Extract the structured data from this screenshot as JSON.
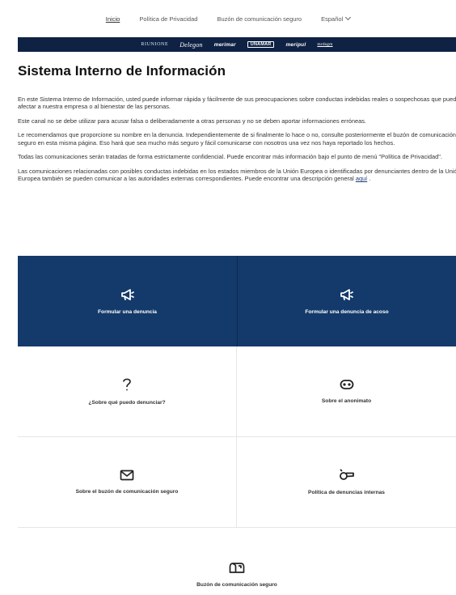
{
  "topnav": {
    "items": [
      {
        "label": "Inicio",
        "active": true
      },
      {
        "label": "Política de Privacidad",
        "active": false
      },
      {
        "label": "Buzón de comunicación seguro",
        "active": false
      }
    ],
    "language": "Español"
  },
  "brands": [
    "RIUNIONE",
    "Delegon",
    "merimar",
    "UNAMAR",
    "meripul",
    "mrdsgm"
  ],
  "page": {
    "title": "Sistema Interno de Información",
    "paragraphs": [
      "En este Sistema Interno de Información, usted puede informar rápida y fácilmente de sus preocupaciones sobre conductas indebidas reales o sospechosas que puedan afectar a nuestra empresa o al bienestar de las personas.",
      "Este canal no se debe utilizar para acusar falsa o deliberadamente a otras personas y no se deben aportar informaciones erróneas.",
      "Le recomendamos que proporcione su nombre en la denuncia. Independientemente de si finalmente lo hace o no, consulte posteriormente el buzón de comunicación seguro en esta misma página. Eso hará que sea mucho más seguro y fácil comunicarse con nosotros una vez nos haya reportado los hechos.",
      "Todas las comunicaciones serán tratadas de forma estrictamente confidencial. Puede encontrar más información bajo el punto de menú \"Política de Privacidad\"."
    ],
    "last_paragraph_text": "Las comunicaciones relacionadas con posibles conductas indebidas en los estados miembros de la Unión Europea o identificadas por denunciantes dentro de la Unión Europea también se pueden comunicar a las autoridades externas correspondientes. Puede encontrar una descripción general ",
    "last_paragraph_link": "aquí",
    "last_paragraph_end": " ."
  },
  "tiles": {
    "report": {
      "label": "Formular una denuncia",
      "icon": "megaphone-icon"
    },
    "harassment": {
      "label": "Formular una denuncia de acoso",
      "icon": "megaphone-icon"
    },
    "what_to_report": {
      "label": "¿Sobre qué puedo denunciar?",
      "icon": "question-icon"
    },
    "anonymity": {
      "label": "Sobre el anonimato",
      "icon": "mask-icon"
    },
    "mailbox_info": {
      "label": "Sobre el buzón de comunicación seguro",
      "icon": "envelope-icon"
    },
    "policy": {
      "label": "Política de denuncias internas",
      "icon": "whistle-icon"
    },
    "mailbox": {
      "label": "Buzón de comunicación seguro",
      "icon": "mailbox-icon"
    }
  },
  "colors": {
    "brandbar": "#0f2244",
    "tile_dark": "#133a6b",
    "link": "#1d3f7a"
  }
}
